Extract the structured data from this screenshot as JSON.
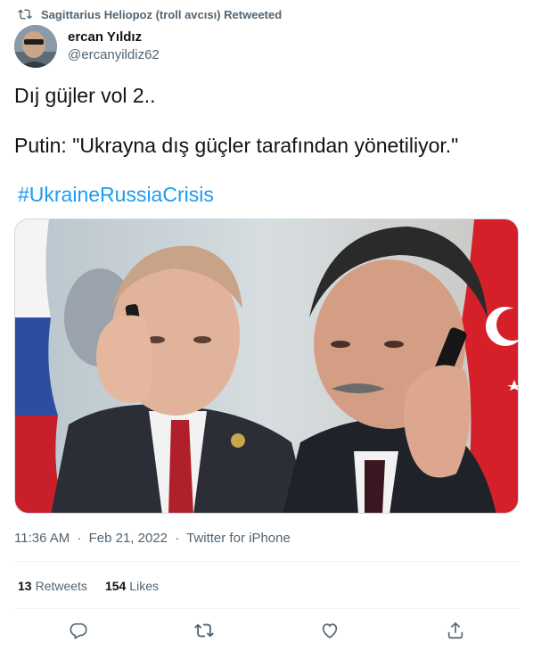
{
  "retweet": {
    "icon": "retweet-icon",
    "text": "Sagittarius Heliopoz (troll avcısı) Retweeted"
  },
  "author": {
    "display_name": "ercan Yıldız",
    "handle": "@ercanyildiz62",
    "avatar_icon": "avatar"
  },
  "tweet": {
    "line1": "Dıj güjler vol 2..",
    "line2": "Putin: \"Ukrayna dış güçler tarafından yönetiliyor.\"",
    "hashtag": "#UkraineRussiaCrisis"
  },
  "meta": {
    "time": "11:36 AM",
    "separator1": "·",
    "date": "Feb 21, 2022",
    "separator2": "·",
    "source": "Twitter for iPhone"
  },
  "stats": {
    "retweets_count": "13",
    "retweets_label": "Retweets",
    "likes_count": "154",
    "likes_label": "Likes"
  },
  "actions": {
    "reply_icon": "reply-icon",
    "retweet_icon": "retweet-icon",
    "like_icon": "heart-icon",
    "share_icon": "share-icon"
  },
  "colors": {
    "text": "#0f1419",
    "secondary": "#536471",
    "link": "#1d9bf0",
    "divider": "#eff3f4"
  }
}
